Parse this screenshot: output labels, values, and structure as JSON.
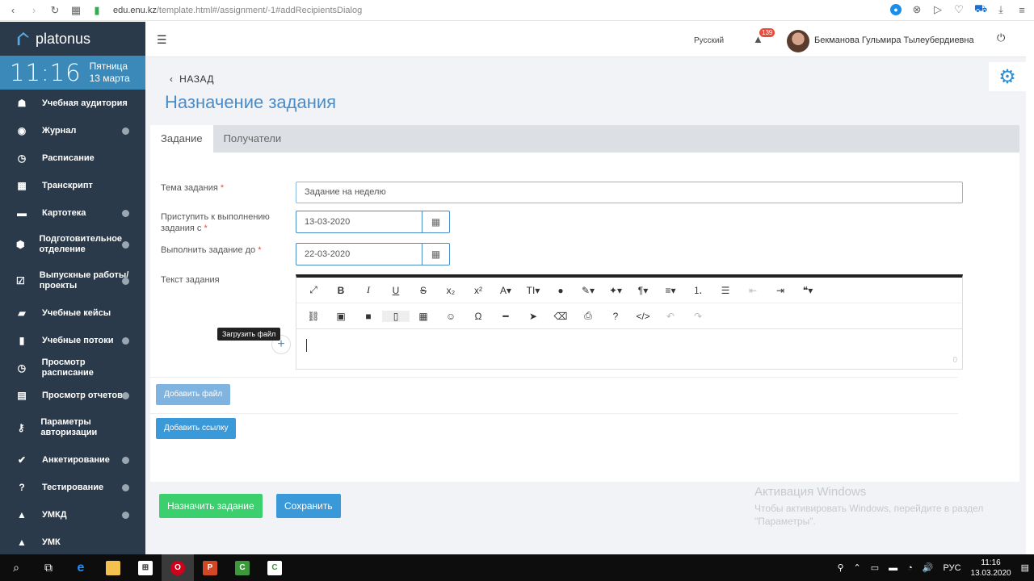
{
  "browser": {
    "url_host": "edu.enu.kz",
    "url_path": "/template.html#/assignment/-1#addRecipientsDialog"
  },
  "sidebar": {
    "logo": "platonus",
    "time": "11:16",
    "weekday": "Пятница",
    "date": "13 марта",
    "items": [
      {
        "label": "Учебная аудитория",
        "icon": "people-icon",
        "chevron": false
      },
      {
        "label": "Журнал",
        "icon": "book-icon",
        "chevron": true
      },
      {
        "label": "Расписание",
        "icon": "clock-icon",
        "chevron": false
      },
      {
        "label": "Транскрипт",
        "icon": "table-icon",
        "chevron": false
      },
      {
        "label": "Картотека",
        "icon": "folder-icon",
        "chevron": true
      },
      {
        "label": "Подготовительное отделение",
        "icon": "cube-icon",
        "chevron": true
      },
      {
        "label": "Выпускные работы/ проекты",
        "icon": "checkbox-icon",
        "chevron": true
      },
      {
        "label": "Учебные кейсы",
        "icon": "briefcase-icon",
        "chevron": false
      },
      {
        "label": "Учебные потоки",
        "icon": "file-icon",
        "chevron": true
      },
      {
        "label": "Просмотр расписание",
        "icon": "clock-icon",
        "chevron": false
      },
      {
        "label": "Просмотр отчетов",
        "icon": "report-icon",
        "chevron": true
      },
      {
        "label": "Параметры авторизации",
        "icon": "key-icon",
        "chevron": false
      },
      {
        "label": "Анкетирование",
        "icon": "check-circle-icon",
        "chevron": true
      },
      {
        "label": "Тестирование",
        "icon": "question-icon",
        "chevron": true
      },
      {
        "label": "УМКД",
        "icon": "graduation-icon",
        "chevron": true
      },
      {
        "label": "УМК",
        "icon": "graduation-icon",
        "chevron": false
      }
    ]
  },
  "topbar": {
    "language": "Русский",
    "notifications": "139",
    "user_name": "Бекманова Гульмира Тылеубердиевна"
  },
  "page": {
    "back": "НАЗАД",
    "title": "Назначение задания",
    "tabs": [
      "Задание",
      "Получатели"
    ],
    "fields": {
      "topic_label": "Тема задания",
      "topic_value": "Задание на неделю",
      "start_label": "Приступить к выполнению задания с",
      "start_value": "13-03-2020",
      "due_label": "Выполнить задание до",
      "due_value": "22-03-2020",
      "text_label": "Текст задания"
    },
    "required_mark": "*",
    "editor_counter": "0",
    "tooltip": "Загрузить файл",
    "add_file": "Добавить файл",
    "add_link": "Добавить ссылку",
    "assign": "Назначить задание",
    "save": "Сохранить"
  },
  "watermark": {
    "title": "Активация Windows",
    "line1": "Чтобы активировать Windows, перейдите в раздел",
    "line2": "\"Параметры\"."
  },
  "taskbar": {
    "lang": "РУС",
    "time": "11:16",
    "date": "13.03.2020"
  },
  "colors": {
    "sidebar_bg": "#2b3a4a",
    "accent": "#4a8cc8",
    "clock_bg": "#3a89b8",
    "assign_btn": "#3ccf6e"
  }
}
